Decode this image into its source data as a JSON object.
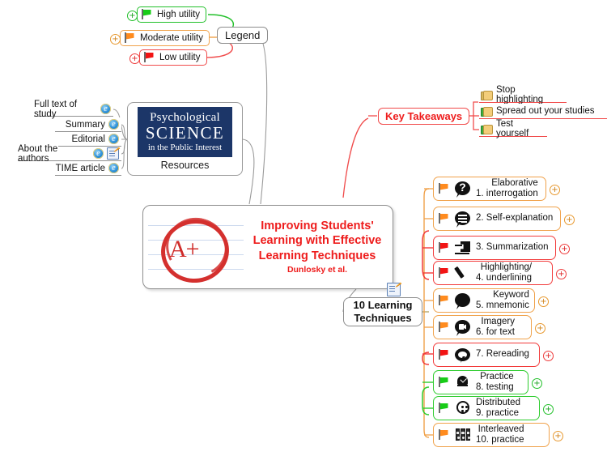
{
  "legend": {
    "title": "Legend",
    "items": [
      {
        "label": "High utility",
        "flag": "green-flag-icon",
        "color": "#22c02a",
        "expandable": true
      },
      {
        "label": "Moderate utility",
        "flag": "orange-flag-icon",
        "color": "#f0a24b",
        "expandable": true
      },
      {
        "label": "Low utility",
        "flag": "red-flag-icon",
        "color": "#f04b4b",
        "expandable": true
      }
    ]
  },
  "resources": {
    "caption": "Resources",
    "logo": {
      "line1": "Psychological",
      "line2": "SCIENCE",
      "line3": "in the Public Interest",
      "background": "#1c3668"
    },
    "links": [
      {
        "label": "Full text of study",
        "icons": [
          "ie-link-icon"
        ]
      },
      {
        "label": "Summary",
        "icons": [
          "ie-link-icon"
        ]
      },
      {
        "label": "Editorial",
        "icons": [
          "ie-link-icon"
        ]
      },
      {
        "label": "About the authors",
        "icons": [
          "ie-link-icon",
          "note-icon"
        ]
      },
      {
        "label": "TIME article",
        "icons": [
          "ie-link-icon"
        ]
      }
    ]
  },
  "key_takeaways": {
    "title": "Key Takeaways",
    "color": "#ee1c1c",
    "items": [
      {
        "label": "Stop highlighting",
        "icon": "thumbs-down-icon"
      },
      {
        "label": "Spread out your studies",
        "icon": "thumbs-up-icon"
      },
      {
        "label": "Test yourself",
        "icon": "thumbs-up-icon"
      }
    ]
  },
  "central": {
    "title_line1": "Improving Students'",
    "title_line2": "Learning with Effective",
    "title_line3": "Learning Techniques",
    "subtitle": "Dunlosky et al.",
    "image": "a-plus-grade-icon",
    "image_text": "A+",
    "color": "#ee1c1c",
    "note": "note-icon"
  },
  "techniques_branch": {
    "title_line1": "10 Learning",
    "title_line2": "Techniques"
  },
  "techniques": [
    {
      "num": "1.",
      "line1": "Elaborative",
      "line2": "interrogation",
      "two_line": true,
      "flag": "orange-flag-icon",
      "utility": "orange",
      "icon": "question-bubble-icon"
    },
    {
      "num": "2.",
      "line1": "Self-explanation",
      "line2": "",
      "two_line": false,
      "flag": "orange-flag-icon",
      "utility": "orange",
      "icon": "lines-bubble-icon"
    },
    {
      "num": "3.",
      "line1": "Summarization",
      "line2": "",
      "two_line": false,
      "flag": "red-flag-icon",
      "utility": "red",
      "icon": "summarize-icon"
    },
    {
      "num": "4.",
      "line1": "Highlighting/",
      "line2": "underlining",
      "two_line": true,
      "flag": "red-flag-icon",
      "utility": "red",
      "icon": "pencil-icon"
    },
    {
      "num": "5.",
      "line1": "Keyword",
      "line2": "mnemonic",
      "two_line": true,
      "flag": "orange-flag-icon",
      "utility": "orange",
      "icon": "keyword-bubble-icon"
    },
    {
      "num": "6.",
      "line1": "Imagery",
      "line2": "for text",
      "two_line": true,
      "flag": "orange-flag-icon",
      "utility": "orange",
      "icon": "image-bubble-icon"
    },
    {
      "num": "7.",
      "line1": "Rereading",
      "line2": "",
      "two_line": false,
      "flag": "red-flag-icon",
      "utility": "red",
      "icon": "reread-loop-icon"
    },
    {
      "num": "8.",
      "line1": "Practice",
      "line2": "testing",
      "two_line": true,
      "flag": "green-flag-icon",
      "utility": "green",
      "icon": "bell-check-icon"
    },
    {
      "num": "9.",
      "line1": "Distributed",
      "line2": "practice",
      "two_line": true,
      "flag": "green-flag-icon",
      "utility": "green",
      "icon": "timer-icon"
    },
    {
      "num": "10.",
      "line1": "Interleaved",
      "line2": "practice",
      "two_line": true,
      "flag": "orange-flag-icon",
      "utility": "orange",
      "icon": "binders-icon"
    }
  ],
  "colors": {
    "high_utility": "#22c02a",
    "moderate_utility": "#f0a24b",
    "low_utility": "#f04b4b",
    "accent_red": "#ee1c1c",
    "connector_gray": "#9a9a9a"
  }
}
